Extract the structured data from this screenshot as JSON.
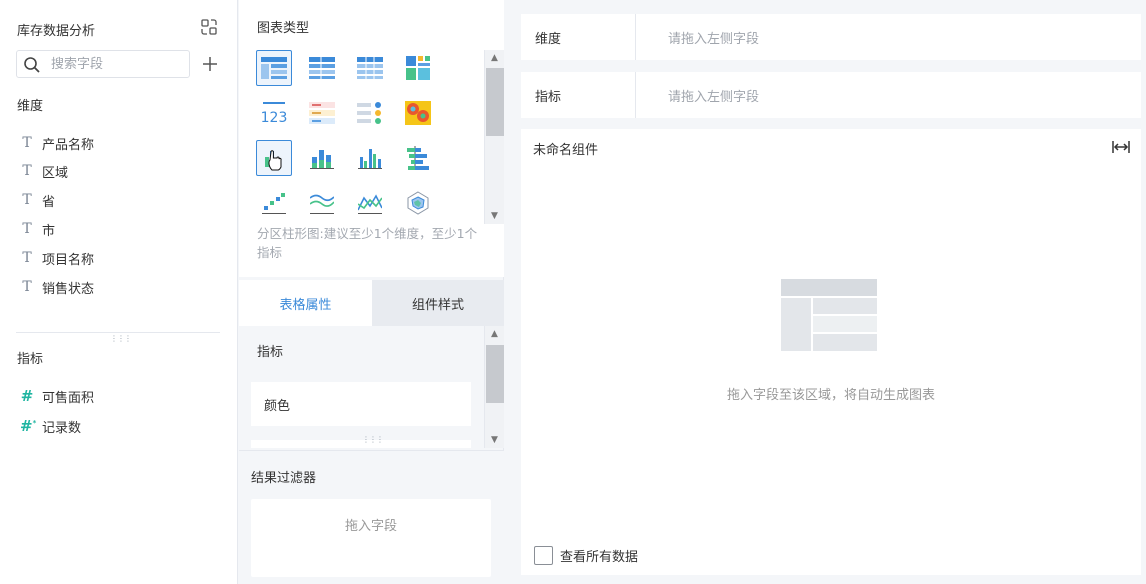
{
  "dataset": {
    "title": "库存数据分析",
    "search_placeholder": "搜索字段",
    "dimensions_label": "维度",
    "dimensions": [
      "产品名称",
      "区域",
      "省",
      "市",
      "项目名称",
      "销售状态"
    ],
    "measures_label": "指标",
    "measures": [
      "可售面积",
      "记录数"
    ]
  },
  "chart_types": {
    "header": "图表类型",
    "hint": "分区柱形图:建议至少1个维度，至少1个指标",
    "icons": [
      "table-icon",
      "cross-table-icon",
      "detail-table-icon",
      "color-block-icon",
      "kpi-number-icon",
      "kpi-table-icon",
      "kpi-dot-icon",
      "heatmap-icon",
      "partition-bar-icon",
      "stacked-bar-icon",
      "grouped-bar-icon",
      "horizontal-bar-icon",
      "scatter-icon",
      "multi-line-icon",
      "line-icon",
      "radar-icon"
    ],
    "selected_index": 8
  },
  "tabs": {
    "active": "表格属性",
    "inactive": "组件样式"
  },
  "properties": {
    "measure_label": "指标",
    "color_label": "颜色"
  },
  "result_filter": {
    "label": "结果过滤器",
    "drop_placeholder": "拖入字段"
  },
  "right": {
    "dimension_label": "维度",
    "dimension_placeholder": "请拖入左侧字段",
    "measure_label": "指标",
    "measure_placeholder": "请拖入左侧字段",
    "widget_title": "未命名组件",
    "empty_text": "拖入字段至该区域，将自动生成图表",
    "view_all_label": "查看所有数据"
  },
  "colors": {
    "accent": "#3b8ad9",
    "measure_icon": "#1fb5a1",
    "background": "#f4f6f9"
  }
}
